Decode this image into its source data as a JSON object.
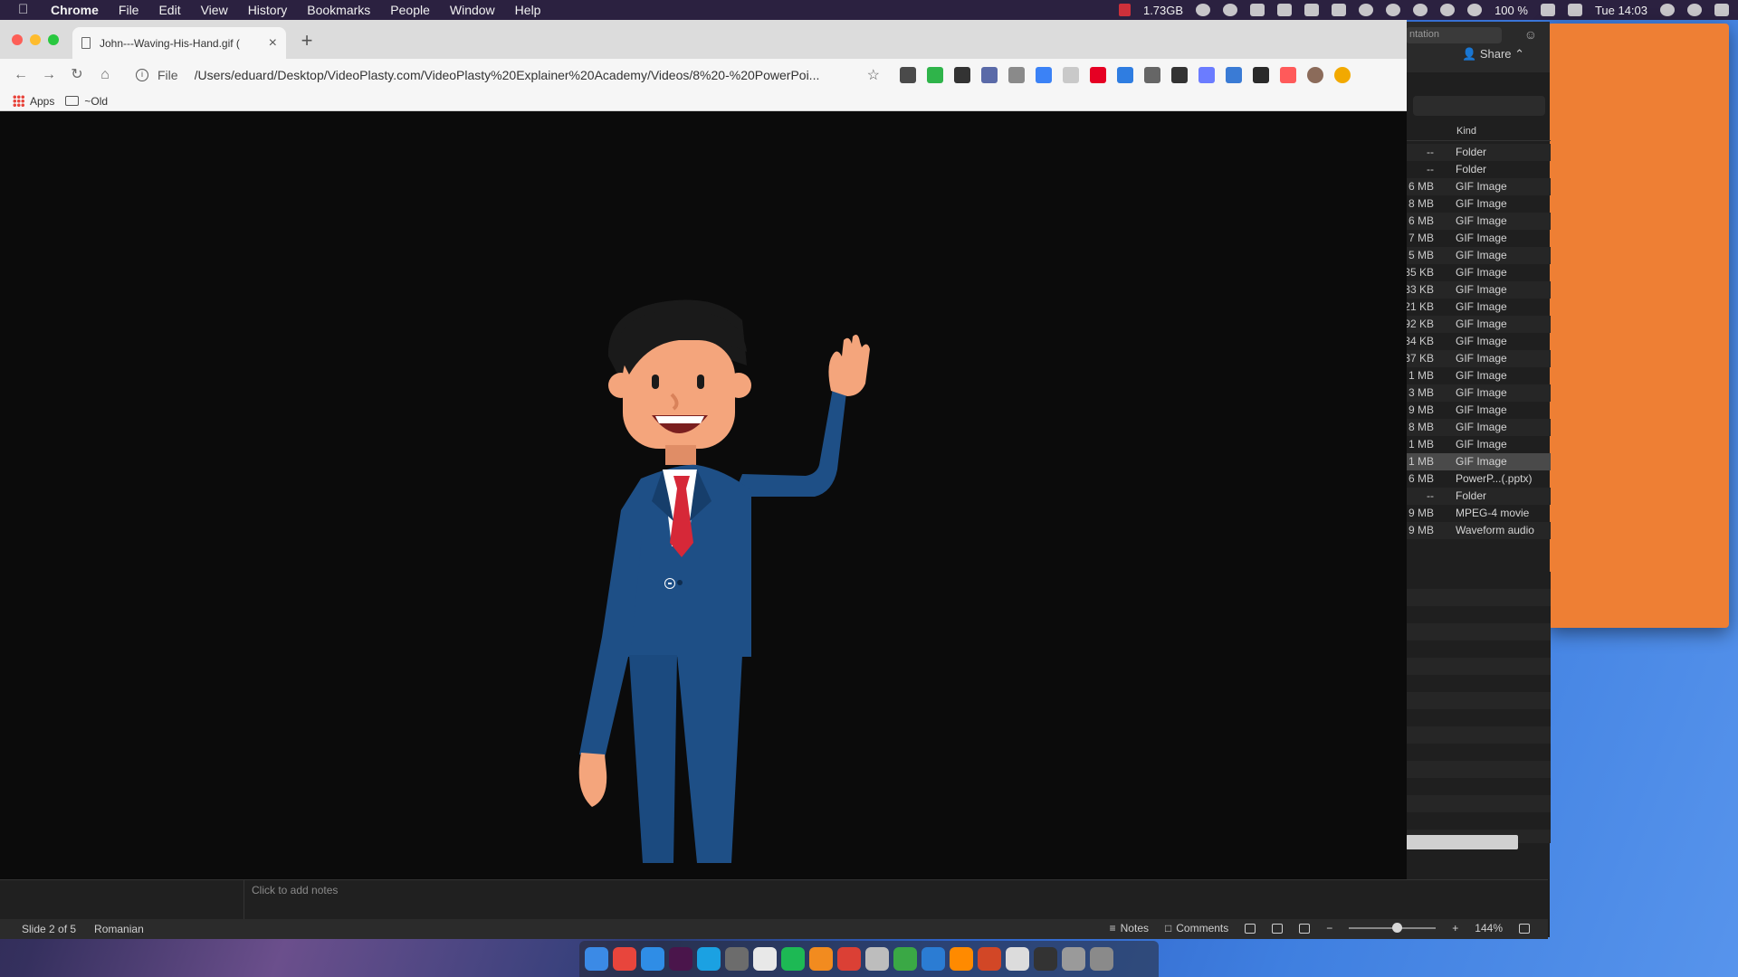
{
  "menubar": {
    "app_name": "Chrome",
    "items": [
      "File",
      "Edit",
      "View",
      "History",
      "Bookmarks",
      "People",
      "Window",
      "Help"
    ],
    "memory": "1.73GB",
    "battery": "100 %",
    "clock": "Tue 14:03"
  },
  "chrome": {
    "tab_title": "John---Waving-His-Hand.gif (",
    "address_scheme": "File",
    "address_url": "/Users/eduard/Desktop/VideoPlasty.com/VideoPlasty%20Explainer%20Academy/Videos/8%20-%20PowerPoi...",
    "bookmarks": [
      {
        "label": "Apps",
        "icon": "apps-grid-icon"
      },
      {
        "label": "~Old",
        "icon": "folder-icon"
      }
    ],
    "extensions": [
      "#4a4a4a",
      "#2fb44a",
      "#333333",
      "#5a6aa8",
      "#8a8a8a",
      "#3b82f6",
      "#c9c9c9",
      "#e60023",
      "#2f7de1",
      "#666666",
      "#333333",
      "#6b7cff",
      "#3a7bd5",
      "#2a2a2a",
      "#ff5a5a"
    ],
    "profile_badge_color": "#f2a900"
  },
  "finder": {
    "presentation_label": "ntation",
    "share_label": "Share",
    "column_kind": "Kind",
    "rows": [
      {
        "size": "--",
        "kind": "Folder"
      },
      {
        "size": "--",
        "kind": "Folder"
      },
      {
        "size": "6 MB",
        "kind": "GIF Image"
      },
      {
        "size": "8 MB",
        "kind": "GIF Image"
      },
      {
        "size": "6 MB",
        "kind": "GIF Image"
      },
      {
        "size": "7 MB",
        "kind": "GIF Image"
      },
      {
        "size": "5 MB",
        "kind": "GIF Image"
      },
      {
        "size": "35 KB",
        "kind": "GIF Image"
      },
      {
        "size": "33 KB",
        "kind": "GIF Image"
      },
      {
        "size": "21 KB",
        "kind": "GIF Image"
      },
      {
        "size": "92 KB",
        "kind": "GIF Image"
      },
      {
        "size": "34 KB",
        "kind": "GIF Image"
      },
      {
        "size": "37 KB",
        "kind": "GIF Image"
      },
      {
        "size": "1 MB",
        "kind": "GIF Image"
      },
      {
        "size": "3 MB",
        "kind": "GIF Image"
      },
      {
        "size": "9 MB",
        "kind": "GIF Image"
      },
      {
        "size": "8 MB",
        "kind": "GIF Image"
      },
      {
        "size": "1 MB",
        "kind": "GIF Image"
      },
      {
        "size": "1 MB",
        "kind": "GIF Image",
        "selected": true
      },
      {
        "size": "6 MB",
        "kind": "PowerP...(.pptx)"
      },
      {
        "size": "--",
        "kind": "Folder"
      },
      {
        "size": "9 MB",
        "kind": "MPEG-4 movie"
      },
      {
        "size": "9 MB",
        "kind": "Waveform audio"
      }
    ]
  },
  "powerpoint": {
    "notes_placeholder": "Click to add notes",
    "slide_indicator": "Slide 2 of 5",
    "language": "Romanian",
    "notes_label": "Notes",
    "comments_label": "Comments",
    "zoom": "144%",
    "zoom_fraction": 0.55
  },
  "colors": {
    "orange_panel": "#ee7f34",
    "suit": "#1e4f86",
    "tie": "#d62838"
  },
  "dock": {
    "apps": [
      {
        "name": "finder-app-icon",
        "color": "#3b8ae6"
      },
      {
        "name": "chrome-app-icon",
        "color": "#e8453c"
      },
      {
        "name": "safari-app-icon",
        "color": "#2f8de6"
      },
      {
        "name": "slack-app-icon",
        "color": "#4a154b"
      },
      {
        "name": "skype-app-icon",
        "color": "#1ba1e2"
      },
      {
        "name": "launchpad-app-icon",
        "color": "#6c6c6c"
      },
      {
        "name": "clock-app-icon",
        "color": "#e8e8e8"
      },
      {
        "name": "spotify-app-icon",
        "color": "#1db954"
      },
      {
        "name": "sublime-app-icon",
        "color": "#f28b1f"
      },
      {
        "name": "todoist-app-icon",
        "color": "#db4035"
      },
      {
        "name": "notes-app-icon",
        "color": "#bdbdbd"
      },
      {
        "name": "camtasia-app-icon",
        "color": "#3aa845"
      },
      {
        "name": "edge-app-icon",
        "color": "#2b7cd3"
      },
      {
        "name": "app-orange-icon",
        "color": "#ff8a00"
      },
      {
        "name": "powerpoint-app-icon",
        "color": "#d24726"
      },
      {
        "name": "preview-app-icon",
        "color": "#dcdcdc"
      },
      {
        "name": "screen-app-icon",
        "color": "#333333"
      },
      {
        "name": "keyboard-app-icon",
        "color": "#9a9a9a"
      },
      {
        "name": "trash-app-icon",
        "color": "#8a8a8a"
      }
    ]
  }
}
